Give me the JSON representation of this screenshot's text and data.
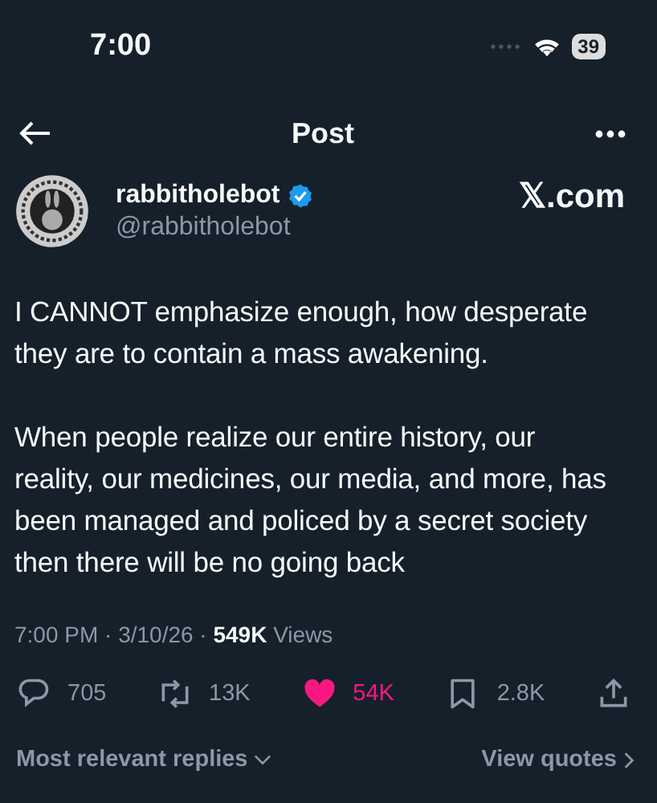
{
  "status_bar": {
    "time": "7:00",
    "battery": "39"
  },
  "header": {
    "title": "Post"
  },
  "author": {
    "name": "rabbitholebot",
    "verified": true,
    "handle": "@rabbitholebot",
    "source": "𝕏.com"
  },
  "post": {
    "paragraphs": [
      "I CANNOT emphasize enough, how desperate they are to contain a mass awakening.",
      "When people realize our entire history, our reality, our medicines, our media, and more, has been managed and policed by a secret society then there will be no going back"
    ],
    "meta": "7:00 PM · 3/10/26 · **549K** Views"
  },
  "actions": [
    {
      "kind": "reply",
      "count": "705"
    },
    {
      "kind": "repost",
      "count": "13K"
    },
    {
      "kind": "like",
      "count": "54K",
      "selected": true
    },
    {
      "kind": "bookmark",
      "count": "2.8K"
    },
    {
      "kind": "share"
    }
  ],
  "footer": {
    "sort": "Most relevant replies",
    "quotes": "View quotes"
  }
}
